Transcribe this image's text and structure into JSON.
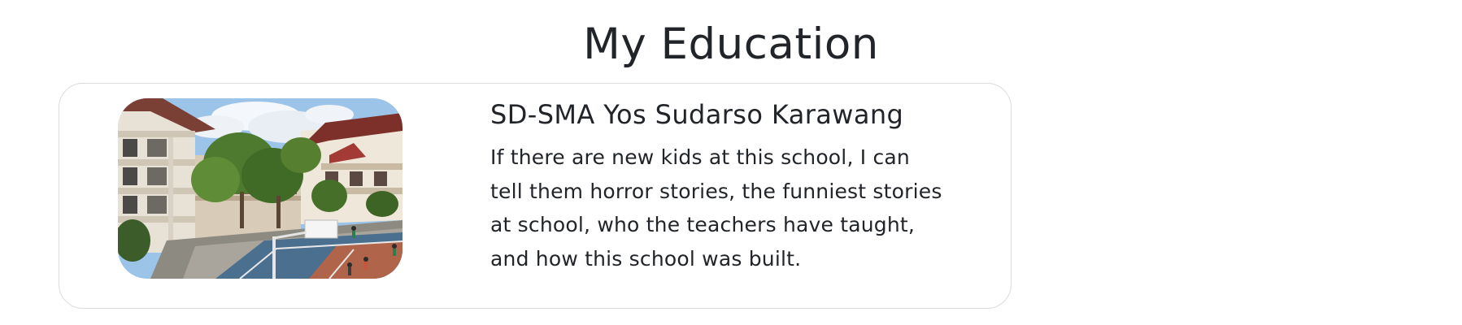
{
  "section": {
    "title": "My Education"
  },
  "education": {
    "school_name": "SD-SMA Yos Sudarso Karawang",
    "description": "If there are new kids at this school, I can tell them horror stories, the funniest stories at school, who the teachers have taught, and how this school was built.",
    "photo_icon": "school-building-photo"
  }
}
